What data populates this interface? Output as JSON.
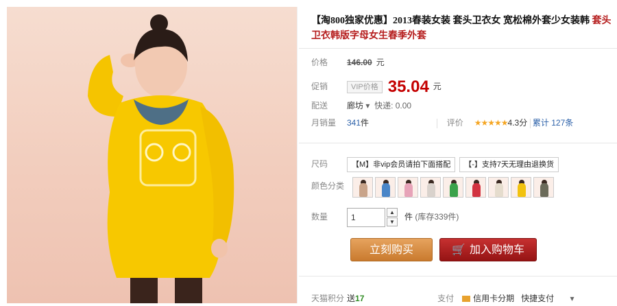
{
  "product": {
    "title_prefix": "【淘800独家优惠】2013春装女装 套头卫衣女 宽松棉外套少女装韩",
    "title_suffix": "套头卫衣韩版字母女生春季外套"
  },
  "price": {
    "label": "价格",
    "original": "146.00",
    "unit": "元"
  },
  "promo": {
    "label": "促销",
    "vip_tag": "VIP价格",
    "value": "35.04",
    "unit": "元"
  },
  "delivery": {
    "label": "配送",
    "location": "廊坊",
    "arrow": "▾",
    "method": "快递: 0.00"
  },
  "sales": {
    "label": "月销量",
    "count": "341",
    "unit": "件",
    "rating_label": "评价",
    "stars": "★★★★★",
    "score": "4.3分",
    "reviews": "累计 127条"
  },
  "size": {
    "label": "尺码",
    "options": [
      "【M】非vip会员请拍下面搭配",
      "【-】支持7天无理由退换货"
    ]
  },
  "color": {
    "label": "颜色分类",
    "swatches": [
      "#c9a48a",
      "#4a86c8",
      "#e7a3b8",
      "#d9d2cc",
      "#3aa24a",
      "#d23340",
      "#e5dccd",
      "#f2c20f",
      "#6b6b5a"
    ]
  },
  "quantity": {
    "label": "数量",
    "value": "1",
    "unit": "件",
    "stock": "(库存339件)"
  },
  "buttons": {
    "buy": "立刻购买",
    "cart": "加入购物车"
  },
  "footer": {
    "points_label": "天猫积分",
    "points_prefix": "送",
    "points_value": "17",
    "pay_label": "支付",
    "credit": "信用卡分期",
    "quick_pay": "快捷支付",
    "more_arrow": "▾"
  }
}
